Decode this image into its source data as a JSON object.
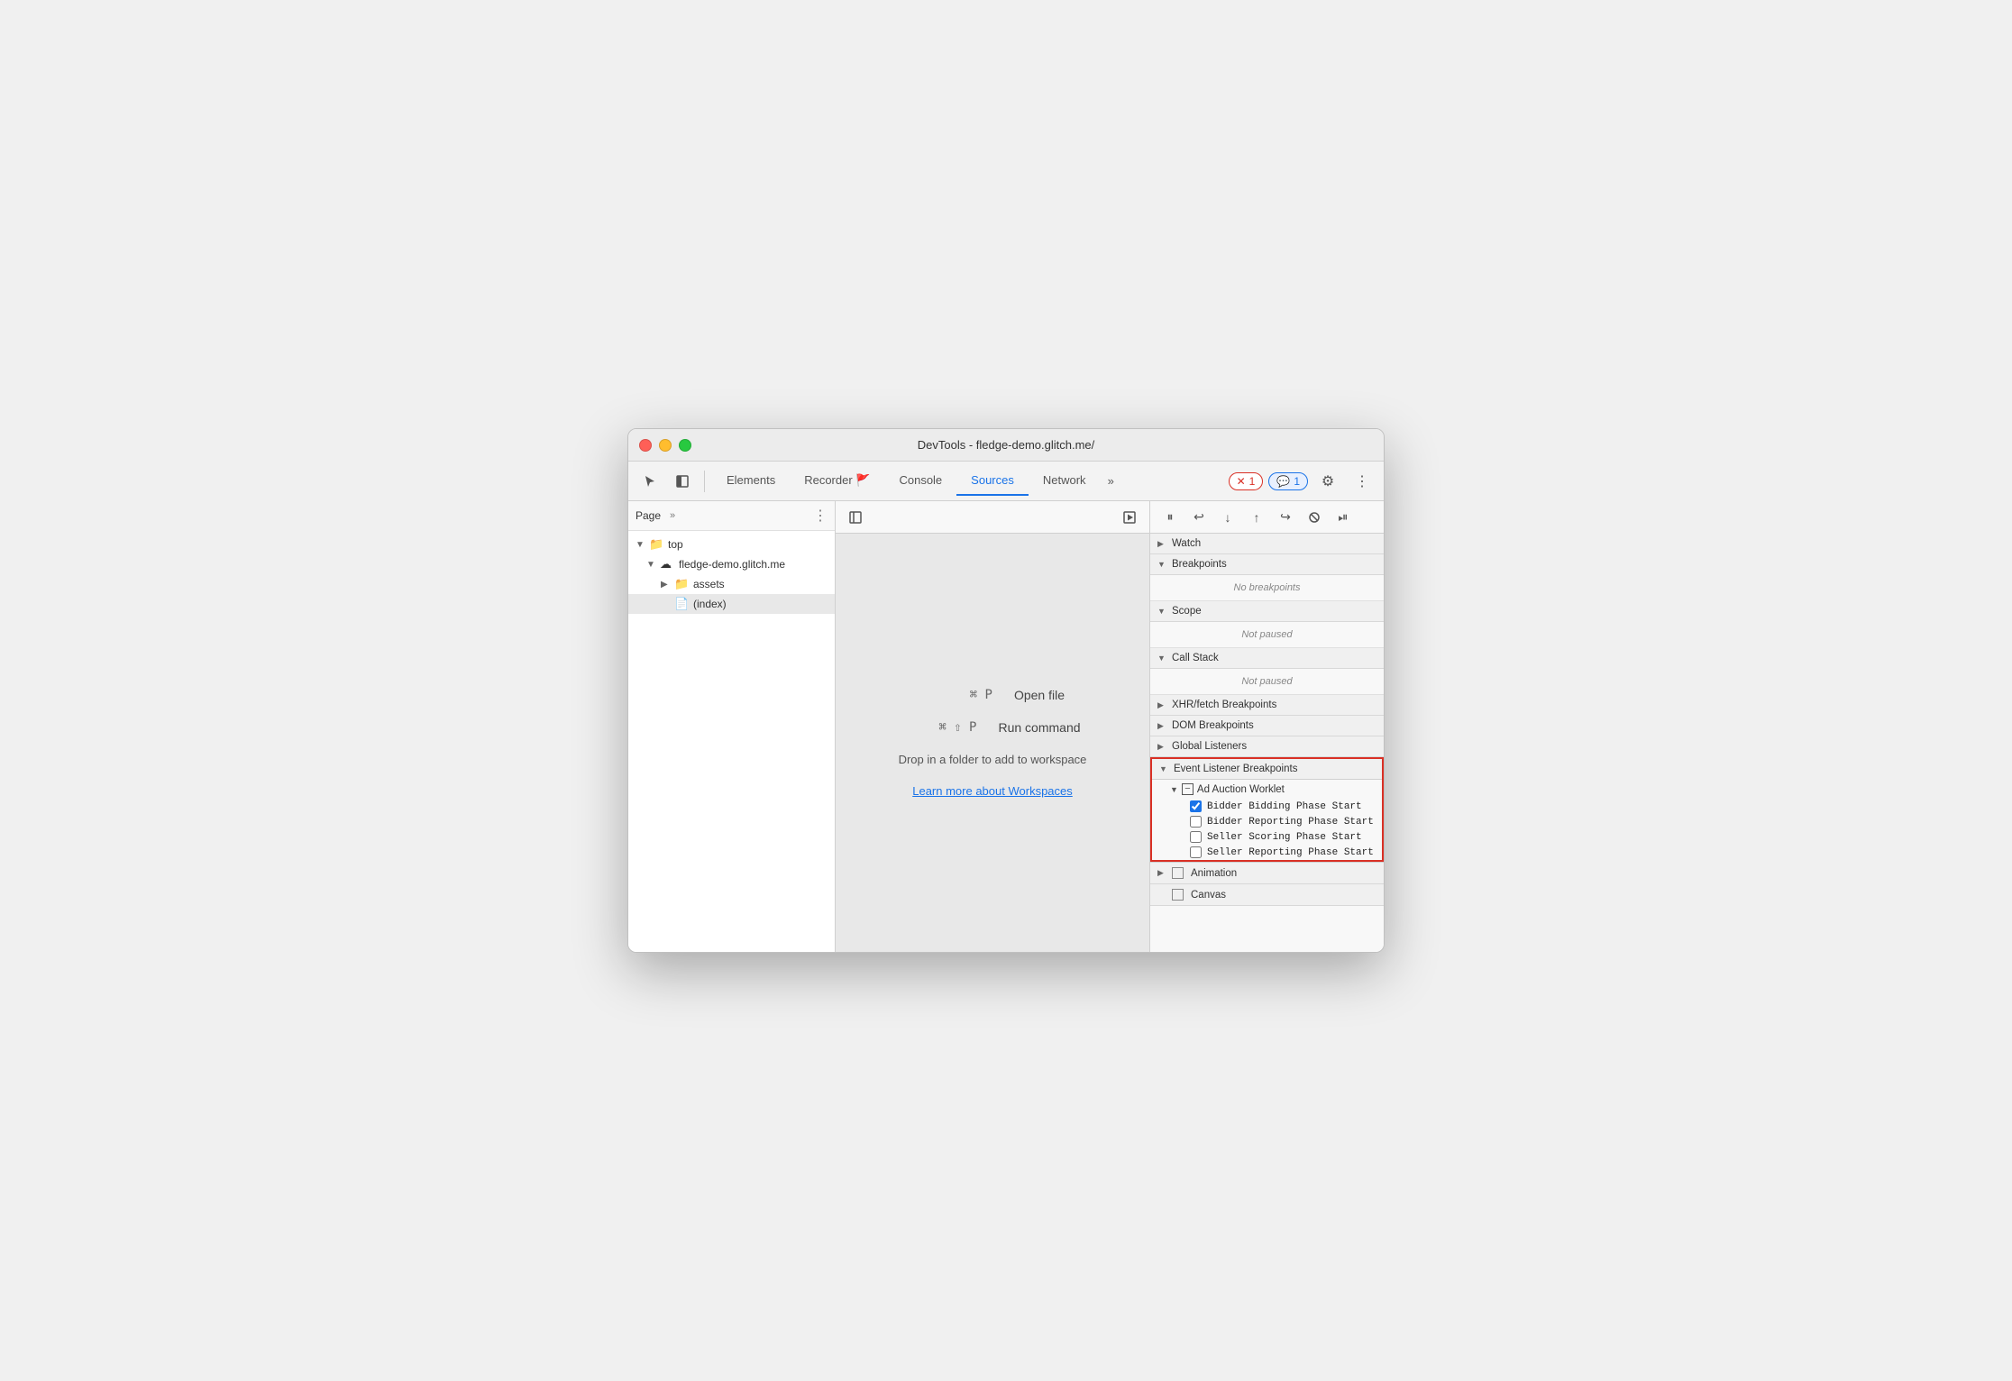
{
  "window": {
    "title": "DevTools - fledge-demo.glitch.me/"
  },
  "toolbar": {
    "tabs": [
      "Elements",
      "Recorder 🚩",
      "Console",
      "Sources",
      "Network"
    ],
    "active_tab": "Sources",
    "more_tabs": "»",
    "error_badge": "1",
    "info_badge": "1"
  },
  "left_panel": {
    "header_label": "Page",
    "header_more": "»",
    "tree": [
      {
        "label": "top",
        "indent": 0,
        "type": "arrow-down",
        "icon": "folder"
      },
      {
        "label": "fledge-demo.glitch.me",
        "indent": 1,
        "type": "arrow-down",
        "icon": "cloud"
      },
      {
        "label": "assets",
        "indent": 2,
        "type": "arrow-right",
        "icon": "folder-blue"
      },
      {
        "label": "(index)",
        "indent": 2,
        "type": "file",
        "icon": "file",
        "selected": true
      }
    ]
  },
  "middle_panel": {
    "shortcut1_key": "⌘ P",
    "shortcut1_label": "Open file",
    "shortcut2_key": "⌘ ⇧ P",
    "shortcut2_label": "Run command",
    "drop_text": "Drop in a folder to add to workspace",
    "workspace_link": "Learn more about Workspaces"
  },
  "right_panel": {
    "sections": [
      {
        "name": "Watch",
        "expanded": false,
        "arrow": "▶"
      },
      {
        "name": "Breakpoints",
        "expanded": true,
        "arrow": "▼",
        "empty_text": "No breakpoints"
      },
      {
        "name": "Scope",
        "expanded": true,
        "arrow": "▼",
        "empty_text": "Not paused"
      },
      {
        "name": "Call Stack",
        "expanded": true,
        "arrow": "▼",
        "empty_text": "Not paused"
      },
      {
        "name": "XHR/fetch Breakpoints",
        "expanded": false,
        "arrow": "▶"
      },
      {
        "name": "DOM Breakpoints",
        "expanded": false,
        "arrow": "▶"
      },
      {
        "name": "Global Listeners",
        "expanded": false,
        "arrow": "▶"
      },
      {
        "name": "Event Listener Breakpoints",
        "expanded": true,
        "arrow": "▼",
        "highlighted": true,
        "sub_sections": [
          {
            "name": "Ad Auction Worklet",
            "arrow": "▼",
            "icon": "minus-box",
            "checkboxes": [
              {
                "label": "Bidder Bidding Phase Start",
                "checked": true
              },
              {
                "label": "Bidder Reporting Phase Start",
                "checked": false
              },
              {
                "label": "Seller Scoring Phase Start",
                "checked": false
              },
              {
                "label": "Seller Reporting Phase Start",
                "checked": false
              }
            ]
          }
        ]
      },
      {
        "name": "Animation",
        "arrow": "▶",
        "has_checkbox": true
      },
      {
        "name": "Canvas",
        "arrow": "",
        "has_checkbox": true
      }
    ]
  }
}
